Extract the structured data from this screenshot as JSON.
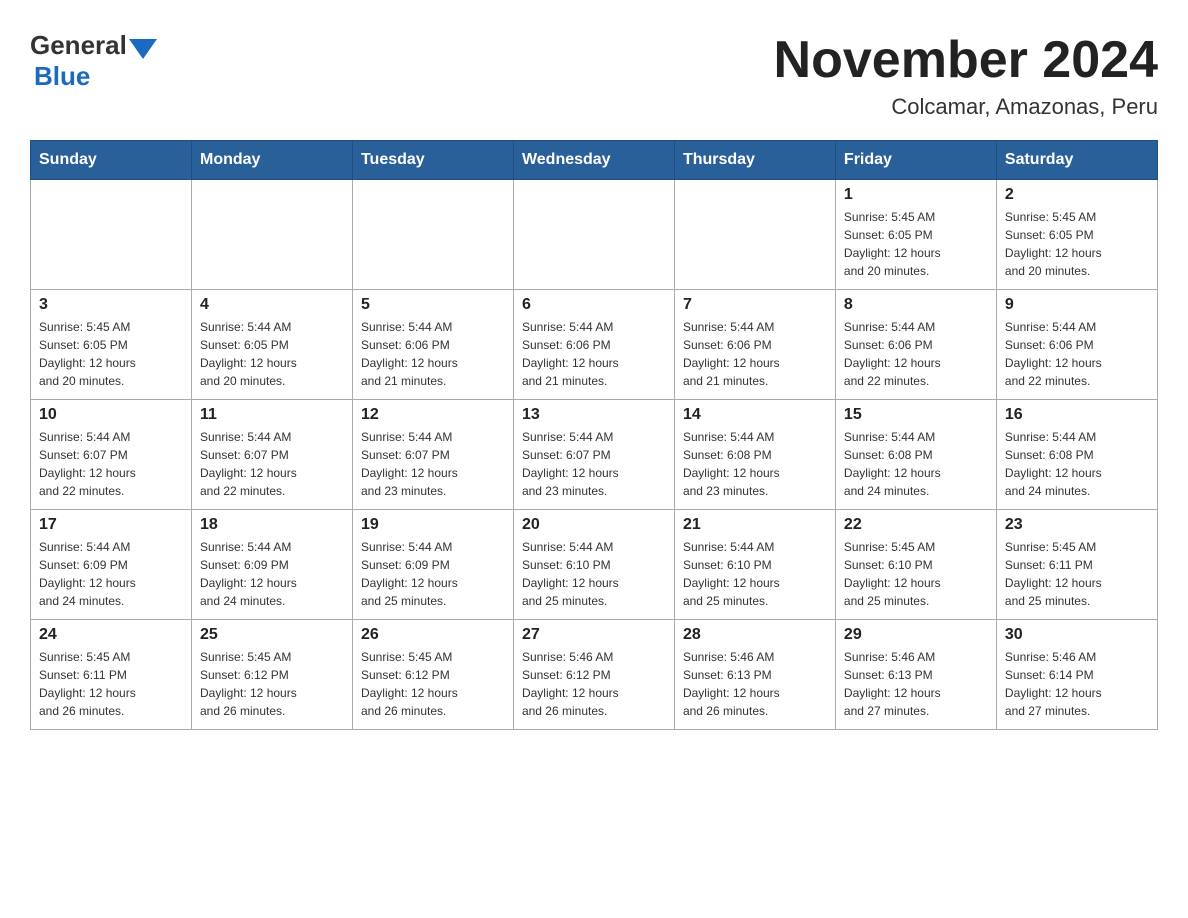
{
  "header": {
    "logo": {
      "general": "General",
      "blue": "Blue"
    },
    "title": "November 2024",
    "location": "Colcamar, Amazonas, Peru"
  },
  "weekdays": [
    "Sunday",
    "Monday",
    "Tuesday",
    "Wednesday",
    "Thursday",
    "Friday",
    "Saturday"
  ],
  "weeks": [
    [
      {
        "day": "",
        "info": ""
      },
      {
        "day": "",
        "info": ""
      },
      {
        "day": "",
        "info": ""
      },
      {
        "day": "",
        "info": ""
      },
      {
        "day": "",
        "info": ""
      },
      {
        "day": "1",
        "info": "Sunrise: 5:45 AM\nSunset: 6:05 PM\nDaylight: 12 hours\nand 20 minutes."
      },
      {
        "day": "2",
        "info": "Sunrise: 5:45 AM\nSunset: 6:05 PM\nDaylight: 12 hours\nand 20 minutes."
      }
    ],
    [
      {
        "day": "3",
        "info": "Sunrise: 5:45 AM\nSunset: 6:05 PM\nDaylight: 12 hours\nand 20 minutes."
      },
      {
        "day": "4",
        "info": "Sunrise: 5:44 AM\nSunset: 6:05 PM\nDaylight: 12 hours\nand 20 minutes."
      },
      {
        "day": "5",
        "info": "Sunrise: 5:44 AM\nSunset: 6:06 PM\nDaylight: 12 hours\nand 21 minutes."
      },
      {
        "day": "6",
        "info": "Sunrise: 5:44 AM\nSunset: 6:06 PM\nDaylight: 12 hours\nand 21 minutes."
      },
      {
        "day": "7",
        "info": "Sunrise: 5:44 AM\nSunset: 6:06 PM\nDaylight: 12 hours\nand 21 minutes."
      },
      {
        "day": "8",
        "info": "Sunrise: 5:44 AM\nSunset: 6:06 PM\nDaylight: 12 hours\nand 22 minutes."
      },
      {
        "day": "9",
        "info": "Sunrise: 5:44 AM\nSunset: 6:06 PM\nDaylight: 12 hours\nand 22 minutes."
      }
    ],
    [
      {
        "day": "10",
        "info": "Sunrise: 5:44 AM\nSunset: 6:07 PM\nDaylight: 12 hours\nand 22 minutes."
      },
      {
        "day": "11",
        "info": "Sunrise: 5:44 AM\nSunset: 6:07 PM\nDaylight: 12 hours\nand 22 minutes."
      },
      {
        "day": "12",
        "info": "Sunrise: 5:44 AM\nSunset: 6:07 PM\nDaylight: 12 hours\nand 23 minutes."
      },
      {
        "day": "13",
        "info": "Sunrise: 5:44 AM\nSunset: 6:07 PM\nDaylight: 12 hours\nand 23 minutes."
      },
      {
        "day": "14",
        "info": "Sunrise: 5:44 AM\nSunset: 6:08 PM\nDaylight: 12 hours\nand 23 minutes."
      },
      {
        "day": "15",
        "info": "Sunrise: 5:44 AM\nSunset: 6:08 PM\nDaylight: 12 hours\nand 24 minutes."
      },
      {
        "day": "16",
        "info": "Sunrise: 5:44 AM\nSunset: 6:08 PM\nDaylight: 12 hours\nand 24 minutes."
      }
    ],
    [
      {
        "day": "17",
        "info": "Sunrise: 5:44 AM\nSunset: 6:09 PM\nDaylight: 12 hours\nand 24 minutes."
      },
      {
        "day": "18",
        "info": "Sunrise: 5:44 AM\nSunset: 6:09 PM\nDaylight: 12 hours\nand 24 minutes."
      },
      {
        "day": "19",
        "info": "Sunrise: 5:44 AM\nSunset: 6:09 PM\nDaylight: 12 hours\nand 25 minutes."
      },
      {
        "day": "20",
        "info": "Sunrise: 5:44 AM\nSunset: 6:10 PM\nDaylight: 12 hours\nand 25 minutes."
      },
      {
        "day": "21",
        "info": "Sunrise: 5:44 AM\nSunset: 6:10 PM\nDaylight: 12 hours\nand 25 minutes."
      },
      {
        "day": "22",
        "info": "Sunrise: 5:45 AM\nSunset: 6:10 PM\nDaylight: 12 hours\nand 25 minutes."
      },
      {
        "day": "23",
        "info": "Sunrise: 5:45 AM\nSunset: 6:11 PM\nDaylight: 12 hours\nand 25 minutes."
      }
    ],
    [
      {
        "day": "24",
        "info": "Sunrise: 5:45 AM\nSunset: 6:11 PM\nDaylight: 12 hours\nand 26 minutes."
      },
      {
        "day": "25",
        "info": "Sunrise: 5:45 AM\nSunset: 6:12 PM\nDaylight: 12 hours\nand 26 minutes."
      },
      {
        "day": "26",
        "info": "Sunrise: 5:45 AM\nSunset: 6:12 PM\nDaylight: 12 hours\nand 26 minutes."
      },
      {
        "day": "27",
        "info": "Sunrise: 5:46 AM\nSunset: 6:12 PM\nDaylight: 12 hours\nand 26 minutes."
      },
      {
        "day": "28",
        "info": "Sunrise: 5:46 AM\nSunset: 6:13 PM\nDaylight: 12 hours\nand 26 minutes."
      },
      {
        "day": "29",
        "info": "Sunrise: 5:46 AM\nSunset: 6:13 PM\nDaylight: 12 hours\nand 27 minutes."
      },
      {
        "day": "30",
        "info": "Sunrise: 5:46 AM\nSunset: 6:14 PM\nDaylight: 12 hours\nand 27 minutes."
      }
    ]
  ]
}
